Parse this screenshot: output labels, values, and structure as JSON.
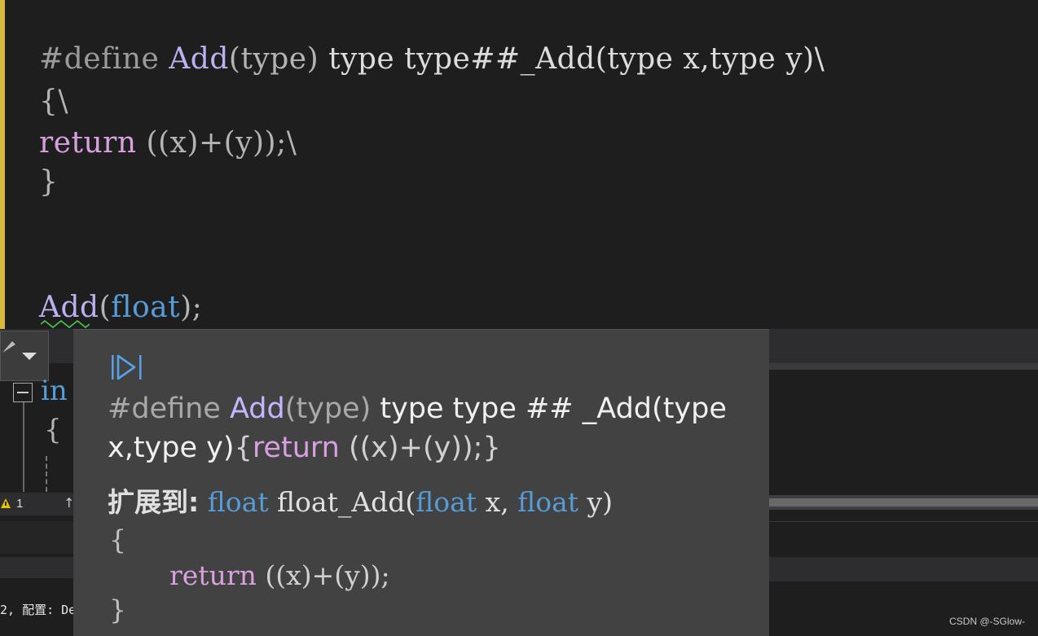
{
  "editor": {
    "lines": {
      "l1": {
        "directive": "#define",
        "name": "Add",
        "rest1": "(",
        "p": "type",
        "rest2": ")",
        "body": " type type##_Add(type x,type y)\\"
      },
      "l2": {
        "text": "{\\"
      },
      "l3": {
        "kw": "return",
        "rest": " ((x)+(y));\\"
      },
      "l4": {
        "text": "}"
      },
      "l5": {
        "name": "Add",
        "open": "(",
        "typ": "float",
        "close": ");"
      }
    },
    "partial_line": {
      "kw": "in",
      "brace": "{"
    }
  },
  "gutter": {
    "warning_count": "1",
    "up_arrow": "↑"
  },
  "quickinfo": {
    "def": {
      "directive": "#define ",
      "name": "Add",
      "param": "(type)",
      "body1": " type type ## _Add(",
      "type1": "type",
      "line2a": "x,type y)",
      "brace": "{",
      "kw": "return",
      "rest": " ((x)+(y));}"
    },
    "expand": {
      "label": "扩展到:",
      "sig_type1": "float",
      "sig_mid": " float_Add(",
      "sig_type2": "float",
      "sig_x": " x, ",
      "sig_type3": "float",
      "sig_y": " y)",
      "open": "{",
      "kw": "return",
      "ret_rest": " ((x)+(y));",
      "close": "}"
    }
  },
  "status": {
    "text": "2, 配置: De"
  },
  "watermark": "CSDN @-SGlow-",
  "colors": {
    "background": "#1e1e1e",
    "popup": "#424242",
    "macro": "#bdb0f0",
    "keyword": "#d8a0df",
    "type": "#569cd6"
  }
}
